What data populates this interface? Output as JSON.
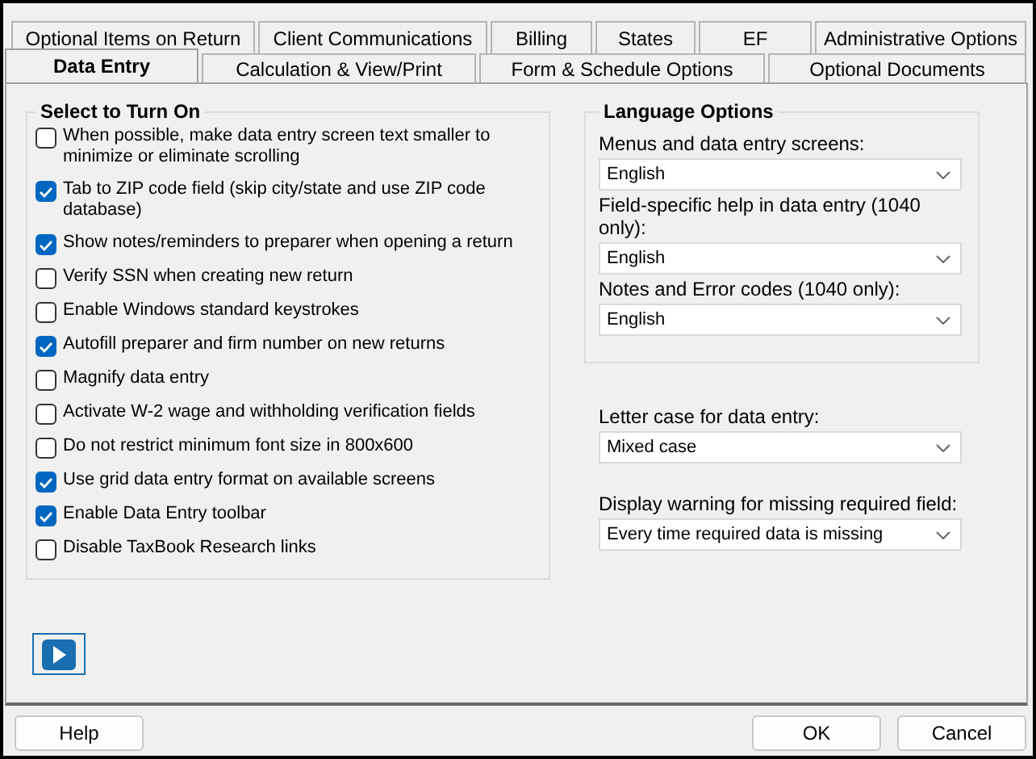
{
  "tabs": {
    "back_row": [
      {
        "label": "Optional Items on Return",
        "selected": false
      },
      {
        "label": "Client Communications",
        "selected": false
      },
      {
        "label": "Billing",
        "selected": false
      },
      {
        "label": "States",
        "selected": false
      },
      {
        "label": "EF",
        "selected": false
      },
      {
        "label": "Administrative Options",
        "selected": false
      }
    ],
    "front_row": [
      {
        "label": "Data Entry",
        "selected": true
      },
      {
        "label": "Calculation & View/Print",
        "selected": false
      },
      {
        "label": "Form & Schedule Options",
        "selected": false
      },
      {
        "label": "Optional Documents",
        "selected": false
      }
    ]
  },
  "select_to_turn_on": {
    "title": "Select to Turn On",
    "options": [
      {
        "label": "When possible, make data entry screen text smaller to minimize or eliminate scrolling",
        "checked": false
      },
      {
        "label": "Tab to ZIP code field (skip city/state and use ZIP code database)",
        "checked": true
      },
      {
        "label": "Show notes/reminders to preparer when opening a return",
        "checked": true
      },
      {
        "label": "Verify SSN when creating new return",
        "checked": false
      },
      {
        "label": "Enable Windows standard keystrokes",
        "checked": false
      },
      {
        "label": "Autofill preparer and firm number on new returns",
        "checked": true
      },
      {
        "label": "Magnify data entry",
        "checked": false
      },
      {
        "label": "Activate W-2 wage and withholding verification fields",
        "checked": false
      },
      {
        "label": "Do not restrict minimum font size in 800x600",
        "checked": false
      },
      {
        "label": "Use grid data entry format on available screens",
        "checked": true
      },
      {
        "label": "Enable Data Entry toolbar",
        "checked": true
      },
      {
        "label": "Disable TaxBook Research links",
        "checked": false
      }
    ]
  },
  "language_options": {
    "title": "Language Options",
    "fields": [
      {
        "label": "Menus and data entry screens:",
        "value": "English"
      },
      {
        "label": "Field-specific help in data entry (1040 only):",
        "value": "English"
      },
      {
        "label": "Notes and Error codes (1040 only):",
        "value": "English"
      }
    ]
  },
  "other_fields": [
    {
      "label": "Letter case for data entry:",
      "value": "Mixed case"
    },
    {
      "label": "Display warning for missing required field:",
      "value": "Every time required data is missing"
    }
  ],
  "footer": {
    "left": [
      "Help"
    ],
    "right": [
      "OK",
      "Cancel"
    ]
  }
}
